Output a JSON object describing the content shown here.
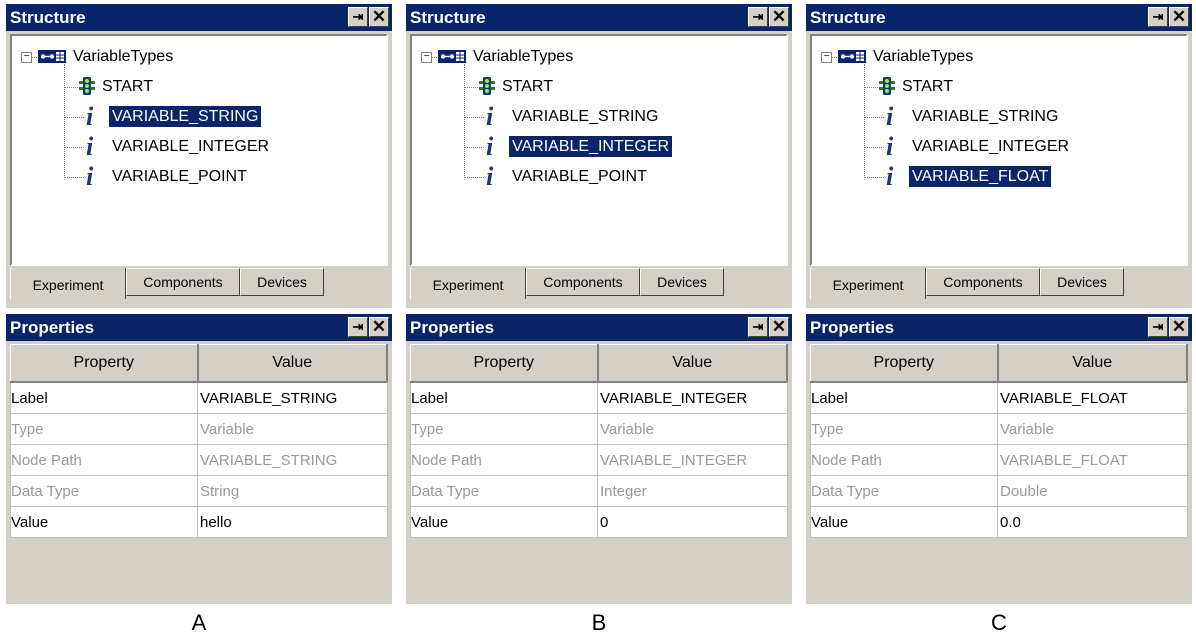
{
  "panels": [
    {
      "caption": "A",
      "structure": {
        "title": "Structure",
        "root": "VariableTypes",
        "nodes": [
          "START",
          "VARIABLE_STRING",
          "VARIABLE_INTEGER",
          "VARIABLE_POINT"
        ],
        "selected_node": "VARIABLE_STRING",
        "tabs": [
          "Experiment",
          "Components",
          "Devices"
        ],
        "active_tab": "Experiment"
      },
      "properties": {
        "title": "Properties",
        "headers": [
          "Property",
          "Value"
        ],
        "rows": [
          {
            "property": "Label",
            "value": "VARIABLE_STRING",
            "readonly": false
          },
          {
            "property": "Type",
            "value": "Variable",
            "readonly": true
          },
          {
            "property": "Node Path",
            "value": "VARIABLE_STRING",
            "readonly": true
          },
          {
            "property": "Data Type",
            "value": "String",
            "readonly": true
          },
          {
            "property": "Value",
            "value": "hello",
            "readonly": false
          }
        ]
      }
    },
    {
      "caption": "B",
      "structure": {
        "title": "Structure",
        "root": "VariableTypes",
        "nodes": [
          "START",
          "VARIABLE_STRING",
          "VARIABLE_INTEGER",
          "VARIABLE_POINT"
        ],
        "selected_node": "VARIABLE_INTEGER",
        "tabs": [
          "Experiment",
          "Components",
          "Devices"
        ],
        "active_tab": "Experiment"
      },
      "properties": {
        "title": "Properties",
        "headers": [
          "Property",
          "Value"
        ],
        "rows": [
          {
            "property": "Label",
            "value": "VARIABLE_INTEGER",
            "readonly": false
          },
          {
            "property": "Type",
            "value": "Variable",
            "readonly": true
          },
          {
            "property": "Node Path",
            "value": "VARIABLE_INTEGER",
            "readonly": true
          },
          {
            "property": "Data Type",
            "value": "Integer",
            "readonly": true
          },
          {
            "property": "Value",
            "value": "0",
            "readonly": false
          }
        ]
      }
    },
    {
      "caption": "C",
      "structure": {
        "title": "Structure",
        "root": "VariableTypes",
        "nodes": [
          "START",
          "VARIABLE_STRING",
          "VARIABLE_INTEGER",
          "VARIABLE_FLOAT"
        ],
        "selected_node": "VARIABLE_FLOAT",
        "tabs": [
          "Experiment",
          "Components",
          "Devices"
        ],
        "active_tab": "Experiment"
      },
      "properties": {
        "title": "Properties",
        "headers": [
          "Property",
          "Value"
        ],
        "rows": [
          {
            "property": "Label",
            "value": "VARIABLE_FLOAT",
            "readonly": false
          },
          {
            "property": "Type",
            "value": "Variable",
            "readonly": true
          },
          {
            "property": "Node Path",
            "value": "VARIABLE_FLOAT",
            "readonly": true
          },
          {
            "property": "Data Type",
            "value": "Double",
            "readonly": true
          },
          {
            "property": "Value",
            "value": "0.0",
            "readonly": false
          }
        ]
      }
    }
  ],
  "icons": {
    "pin": "pin-icon",
    "close": "close-icon",
    "root": "component-icon",
    "start": "start-traffic-light-icon",
    "variable": "variable-info-icon"
  },
  "colors": {
    "titlebar": "#0a246a",
    "selection": "#0a246a",
    "panel_bg": "#d4d0c8",
    "readonly_text": "#999999"
  }
}
